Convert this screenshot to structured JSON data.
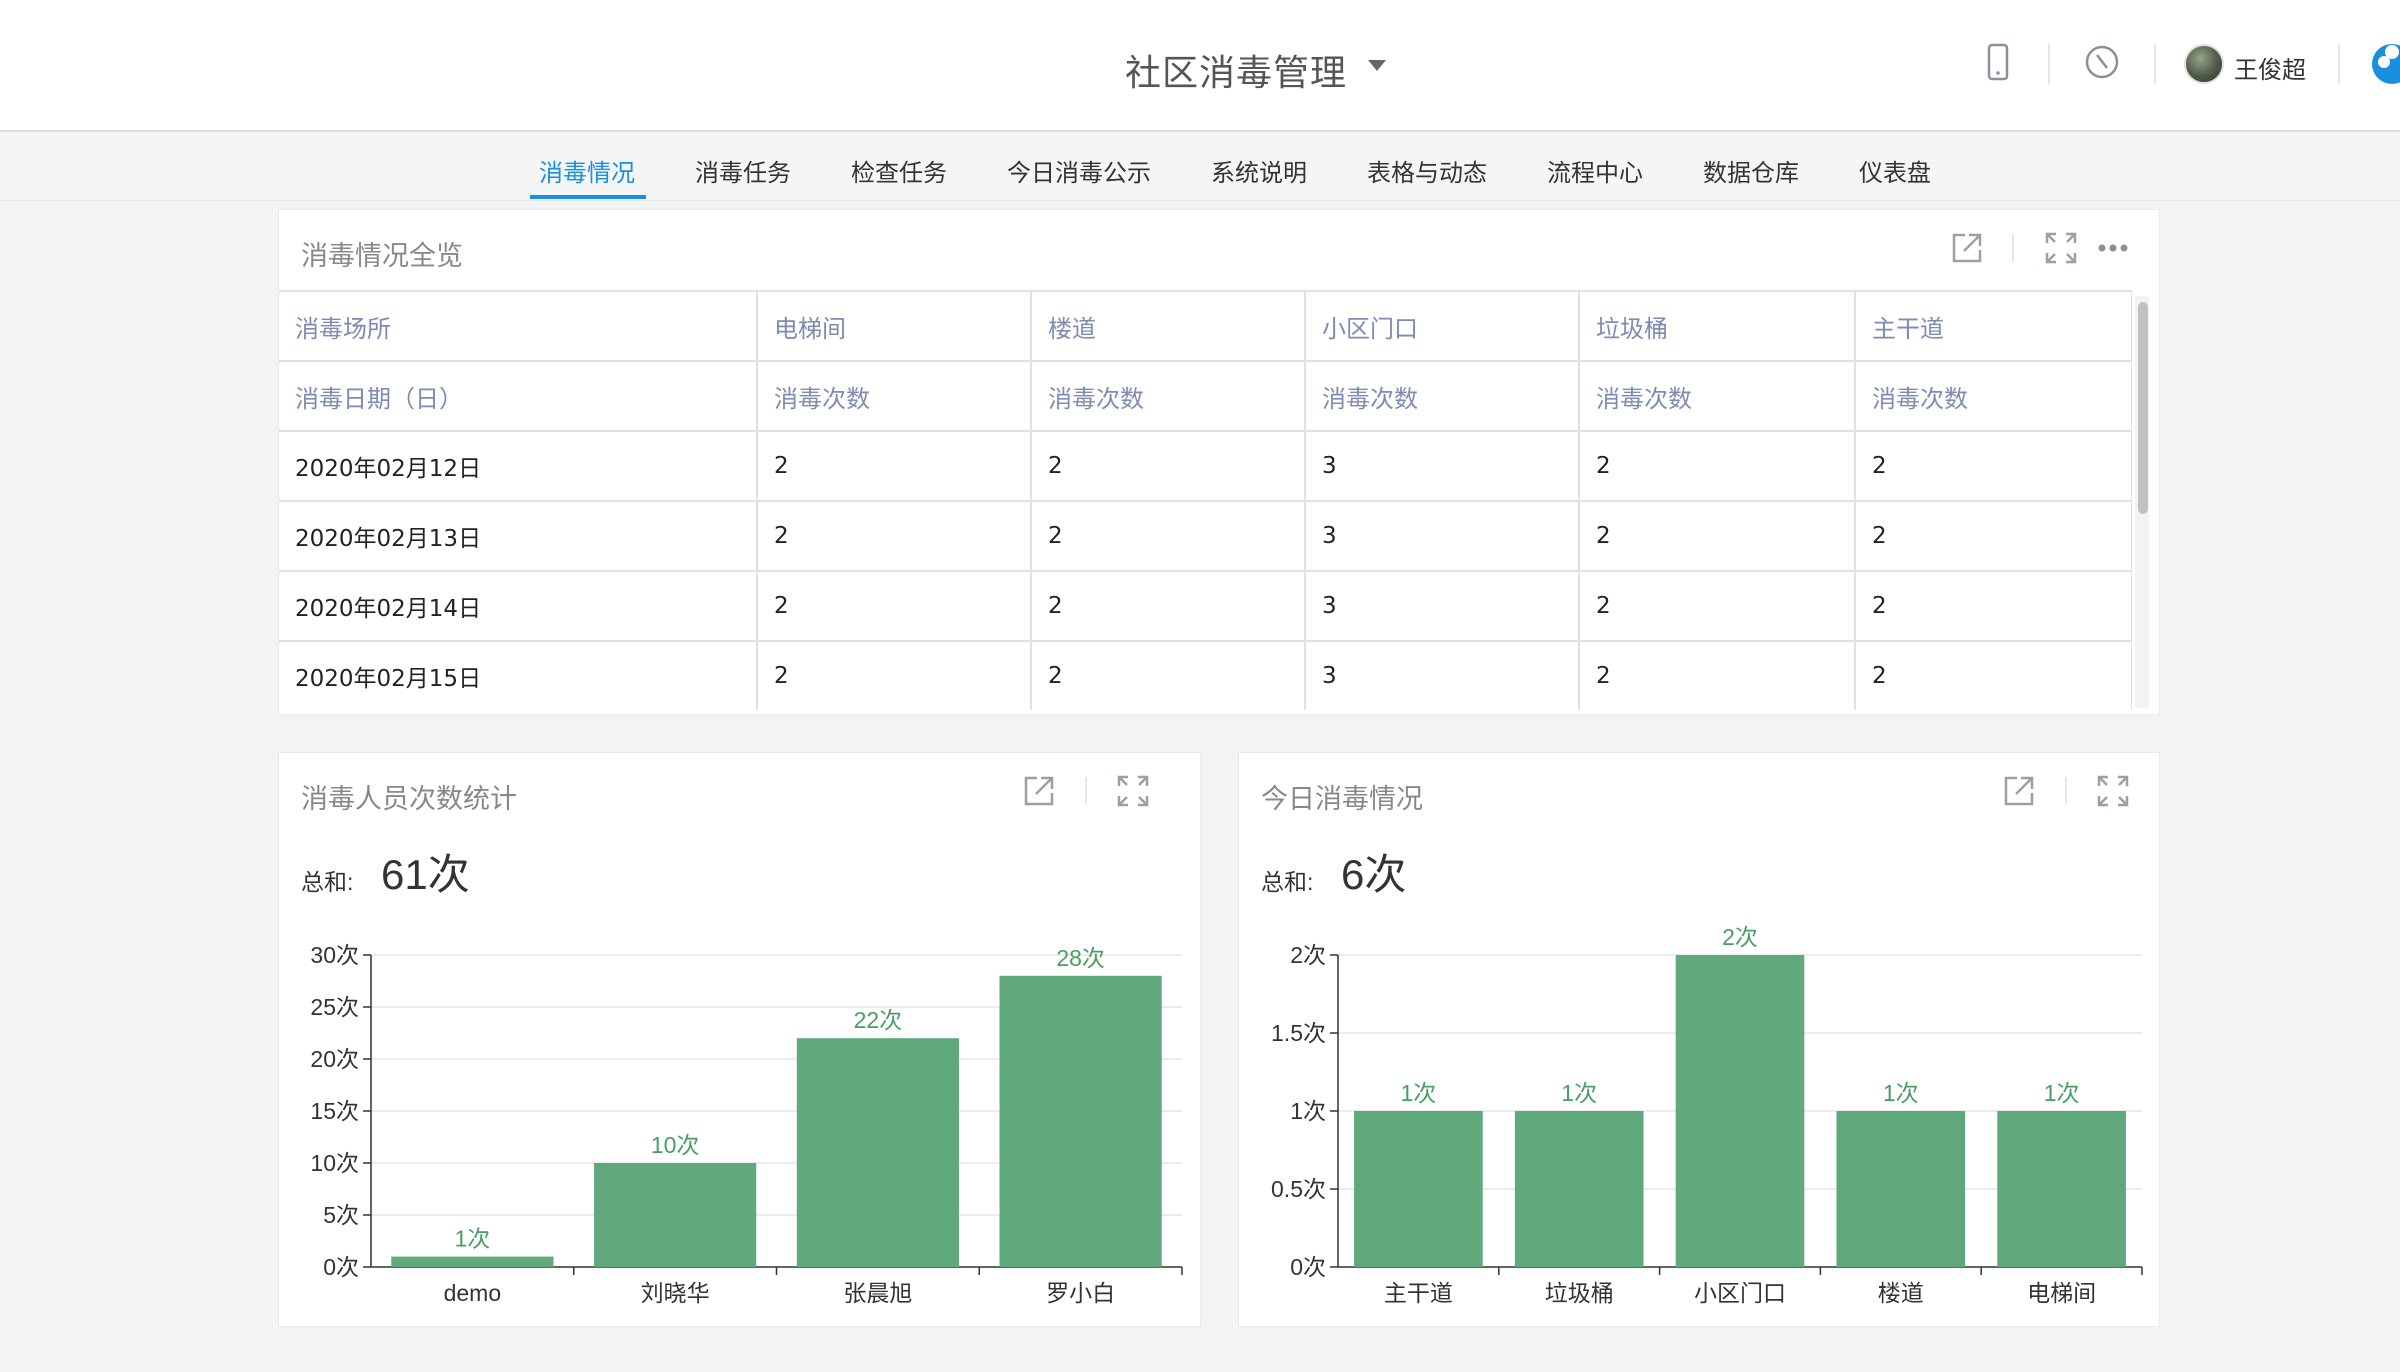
{
  "header": {
    "app_title": "社区消毒管理",
    "user_name": "王俊超",
    "icons": [
      "mobile-icon",
      "compass-icon",
      "avatar",
      "cloud-icon"
    ]
  },
  "nav": {
    "items": [
      {
        "label": "消毒情况",
        "active": true
      },
      {
        "label": "消毒任务"
      },
      {
        "label": "检查任务"
      },
      {
        "label": "今日消毒公示"
      },
      {
        "label": "系统说明"
      },
      {
        "label": "表格与动态"
      },
      {
        "label": "流程中心"
      },
      {
        "label": "数据仓库"
      },
      {
        "label": "仪表盘"
      }
    ]
  },
  "overview": {
    "title": "消毒情况全览",
    "header_row1": [
      "消毒场所",
      "电梯间",
      "楼道",
      "小区门口",
      "垃圾桶",
      "主干道"
    ],
    "header_row2": [
      "消毒日期（日）",
      "消毒次数",
      "消毒次数",
      "消毒次数",
      "消毒次数",
      "消毒次数"
    ],
    "rows": [
      [
        "2020年02月12日",
        "2",
        "2",
        "3",
        "2",
        "2"
      ],
      [
        "2020年02月13日",
        "2",
        "2",
        "3",
        "2",
        "2"
      ],
      [
        "2020年02月14日",
        "2",
        "2",
        "3",
        "2",
        "2"
      ],
      [
        "2020年02月15日",
        "2",
        "2",
        "3",
        "2",
        "2"
      ]
    ]
  },
  "staff_panel": {
    "title": "消毒人员次数统计",
    "sum_label": "总和:",
    "sum_value": "61次"
  },
  "today_panel": {
    "title": "今日消毒情况",
    "sum_label": "总和:",
    "sum_value": "6次"
  },
  "colors": {
    "bar": "#5fa97d",
    "accent": "#1a8fdd",
    "label": "#4a9d64"
  },
  "chart_data": [
    {
      "type": "bar",
      "categories": [
        "demo",
        "刘晓华",
        "张晨旭",
        "罗小白"
      ],
      "values": [
        1,
        10,
        22,
        28
      ],
      "data_labels": [
        "1次",
        "10次",
        "22次",
        "28次"
      ],
      "ylim": [
        0,
        30
      ],
      "yticks": [
        0,
        5,
        10,
        15,
        20,
        25,
        30
      ],
      "ytick_labels": [
        "0次",
        "5次",
        "10次",
        "15次",
        "20次",
        "25次",
        "30次"
      ],
      "grid": true
    },
    {
      "type": "bar",
      "categories": [
        "主干道",
        "垃圾桶",
        "小区门口",
        "楼道",
        "电梯间"
      ],
      "values": [
        1,
        1,
        2,
        1,
        1
      ],
      "data_labels": [
        "1次",
        "1次",
        "2次",
        "1次",
        "1次"
      ],
      "ylim": [
        0,
        2
      ],
      "yticks": [
        0,
        0.5,
        1,
        1.5,
        2
      ],
      "ytick_labels": [
        "0次",
        "0.5次",
        "1次",
        "1.5次",
        "2次"
      ],
      "grid": true
    }
  ]
}
